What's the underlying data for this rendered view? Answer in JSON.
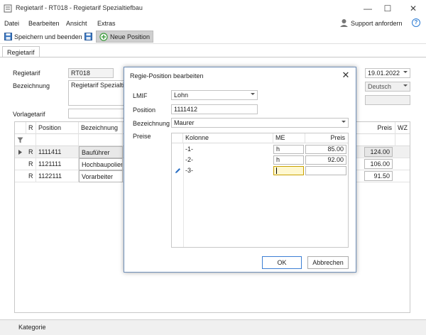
{
  "window": {
    "title": "Regietarif - RT018 - Regietarif Spezialtiefbau",
    "controls": {
      "minimize": "—",
      "maximize": "☐",
      "close": "✕"
    }
  },
  "menu": {
    "items": [
      "Datei",
      "Bearbeiten",
      "Ansicht",
      "Extras"
    ],
    "support_label": "Support anfordern",
    "help_glyph": "?"
  },
  "toolbar": {
    "save_label": "Speichern und beenden",
    "new_label": "Neue Position"
  },
  "tab": {
    "label": "Regietarif"
  },
  "form": {
    "regietarif_label": "Regietarif",
    "regietarif_value": "RT018",
    "bezeichnung_label": "Bezeichnung",
    "bezeichnung_value": "Regietarif Spezialtiefb",
    "vorlagetarif_label": "Vorlagetarif",
    "date_value": "19.01.2022",
    "language_value": "Deutsch"
  },
  "grid": {
    "headers": {
      "r": "R",
      "position": "Position",
      "bezeichnung": "Bezeichnung",
      "preis": "Preis",
      "wz": "WZ"
    },
    "rows": [
      {
        "r": "R",
        "position": "1111411",
        "bezeichnung": "Bauführer",
        "preis": "124.00"
      },
      {
        "r": "R",
        "position": "1121111",
        "bezeichnung": "Hochbaupolier",
        "preis": "106.00"
      },
      {
        "r": "R",
        "position": "1122111",
        "bezeichnung": "Vorarbeiter",
        "preis": "91.50"
      }
    ]
  },
  "status": {
    "label": "Kategorie"
  },
  "dialog": {
    "title": "Regie-Position bearbeiten",
    "lmif_label": "LMIF",
    "lmif_value": "Lohn",
    "position_label": "Position",
    "position_value": "1111412",
    "bezeichnung_label": "Bezeichnung",
    "bezeichnung_value": "Maurer",
    "preise_label": "Preise",
    "prices": {
      "headers": {
        "kolonne": "Kolonne",
        "me": "ME",
        "preis": "Preis"
      },
      "rows": [
        {
          "kolonne": "-1-",
          "me": "h",
          "preis": "85.00"
        },
        {
          "kolonne": "-2-",
          "me": "h",
          "preis": "92.00"
        },
        {
          "kolonne": "-3-",
          "me": "",
          "preis": ""
        }
      ]
    },
    "ok_label": "OK",
    "cancel_label": "Abbrechen"
  }
}
